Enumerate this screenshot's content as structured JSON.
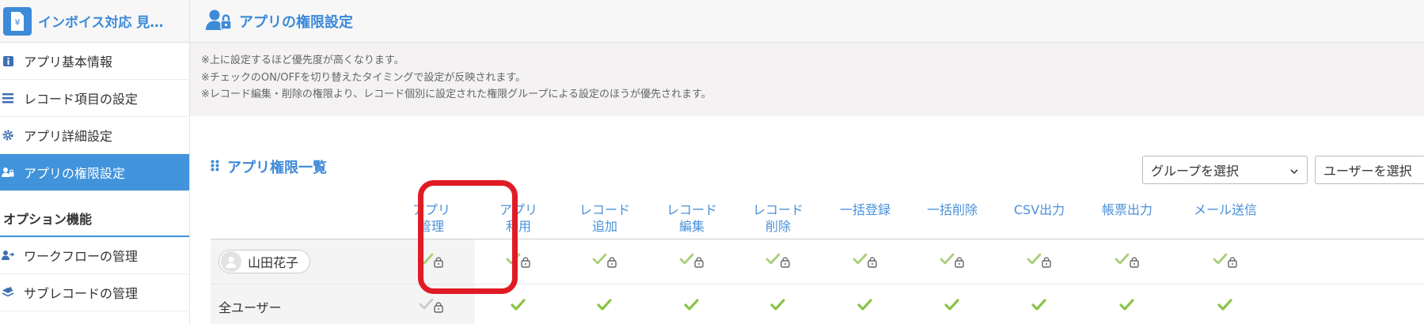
{
  "sidebar": {
    "app_title": "インボイス対応 見…",
    "items": [
      {
        "label": "アプリ基本情報",
        "icon": "info-icon"
      },
      {
        "label": "レコード項目の設定",
        "icon": "list-icon"
      },
      {
        "label": "アプリ詳細設定",
        "icon": "gear-icon"
      },
      {
        "label": "アプリの権限設定",
        "icon": "user-lock-icon",
        "active": true
      }
    ],
    "option_heading": "オプション機能",
    "option_items": [
      {
        "label": "ワークフローの管理",
        "icon": "workflow-icon"
      },
      {
        "label": "サブレコードの管理",
        "icon": "layers-icon"
      }
    ]
  },
  "header": {
    "title": "アプリの権限設定"
  },
  "notes": [
    "※上に設定するほど優先度が高くなります。",
    "※チェックのON/OFFを切り替えたタイミングで設定が反映されます。",
    "※レコード編集・削除の権限より、レコード個別に設定された権限グループによる設定のほうが優先されます。"
  ],
  "list": {
    "title": "アプリ権限一覧",
    "group_select": "グループを選択",
    "user_select": "ユーザーを選択"
  },
  "columns": [
    {
      "line1": "アプリ",
      "line2": "管理"
    },
    {
      "line1": "アプリ",
      "line2": "利用"
    },
    {
      "line1": "レコード",
      "line2": "追加"
    },
    {
      "line1": "レコード",
      "line2": "編集"
    },
    {
      "line1": "レコード",
      "line2": "削除"
    },
    {
      "line1": "一括登録",
      "line2": ""
    },
    {
      "line1": "一括削除",
      "line2": ""
    },
    {
      "line1": "CSV出力",
      "line2": ""
    },
    {
      "line1": "帳票出力",
      "line2": ""
    },
    {
      "line1": "メール送信",
      "line2": ""
    }
  ],
  "rows": [
    {
      "label": "山田花子",
      "type": "user",
      "cells": [
        "locked-check",
        "locked-check",
        "locked-check",
        "locked-check",
        "locked-check",
        "locked-check",
        "locked-check",
        "locked-check",
        "locked-check",
        "locked-check"
      ]
    },
    {
      "label": "全ユーザー",
      "type": "group",
      "cells": [
        "locked-grey",
        "check",
        "check",
        "check",
        "check",
        "check",
        "check",
        "check",
        "check",
        "check"
      ]
    }
  ],
  "colors": {
    "accent": "#3d8ad8",
    "check": "#8bc34a",
    "check_light": "#a9cf7a",
    "highlight": "#e01b24"
  }
}
